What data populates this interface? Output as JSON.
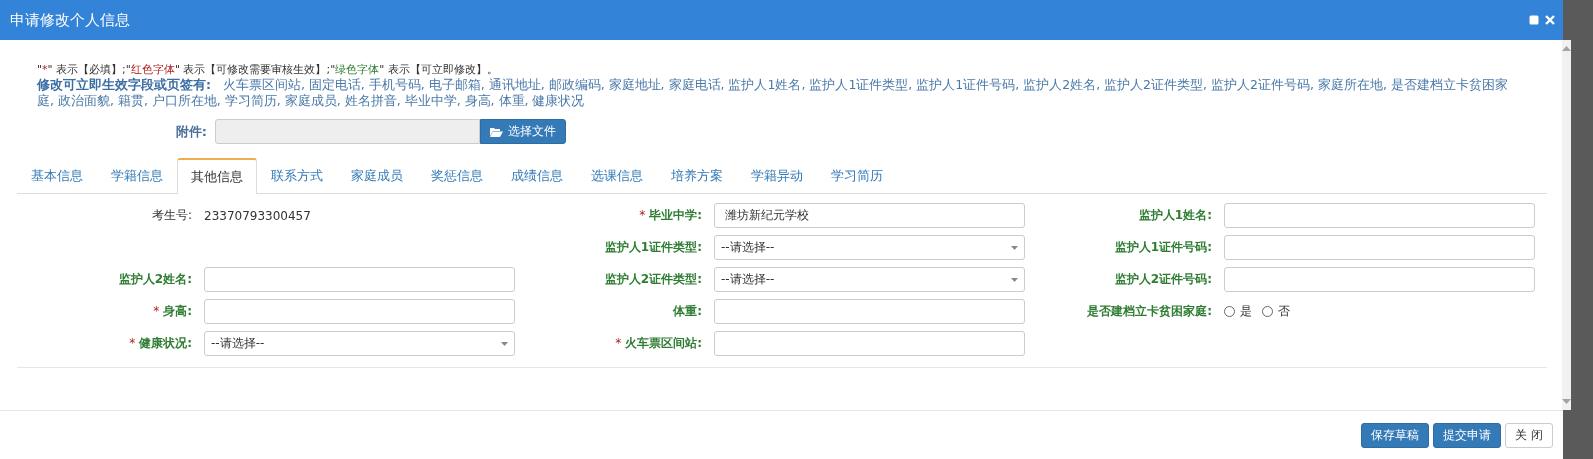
{
  "window": {
    "title": "申请修改个人信息"
  },
  "legend": [
    {
      "text": "\"",
      "kind": "plain"
    },
    {
      "text": "*",
      "kind": "red"
    },
    {
      "text": "\" 表示【必填】;\"",
      "kind": "plain"
    },
    {
      "text": "红色字体",
      "kind": "red"
    },
    {
      "text": "\" 表示【可修改需要审核生效】;\"",
      "kind": "plain"
    },
    {
      "text": "绿色字体",
      "kind": "green"
    },
    {
      "text": "\" 表示【可立即修改】。",
      "kind": "plain"
    }
  ],
  "instant_fields": {
    "label": "修改可立即生效字段或页签有:",
    "text": "火车票区间站, 固定电话, 手机号码, 电子邮箱, 通讯地址, 邮政编码, 家庭地址, 家庭电话, 监护人1姓名, 监护人1证件类型, 监护人1证件号码, 监护人2姓名, 监护人2证件类型, 监护人2证件号码, 家庭所在地, 是否建档立卡贫困家庭, 政治面貌, 籍贯, 户口所在地, 学习简历, 家庭成员, 姓名拼音, 毕业中学, 身高, 体重, 健康状况"
  },
  "attachment": {
    "label": "附件:",
    "button": "选择文件"
  },
  "tabs": [
    {
      "label": "基本信息",
      "selected": false
    },
    {
      "label": "学籍信息",
      "selected": false
    },
    {
      "label": "其他信息",
      "selected": true
    },
    {
      "label": "联系方式",
      "selected": false
    },
    {
      "label": "家庭成员",
      "selected": false
    },
    {
      "label": "奖惩信息",
      "selected": false
    },
    {
      "label": "成绩信息",
      "selected": false
    },
    {
      "label": "选课信息",
      "selected": false
    },
    {
      "label": "培养方案",
      "selected": false
    },
    {
      "label": "学籍异动",
      "selected": false
    },
    {
      "label": "学习简历",
      "selected": false
    }
  ],
  "form": [
    {
      "kind": "readonly",
      "label": "考生号:",
      "required": false,
      "value": "23370793300457"
    },
    {
      "kind": "text",
      "label": "毕业中学:",
      "required": true,
      "value": "潍坊新纪元学校"
    },
    {
      "kind": "text",
      "label": "监护人1姓名:",
      "required": false
    },
    {
      "kind": "blank"
    },
    {
      "kind": "select",
      "label": "监护人1证件类型:",
      "required": false,
      "value": "--请选择--"
    },
    {
      "kind": "text",
      "label": "监护人1证件号码:",
      "required": false
    },
    {
      "kind": "text",
      "label": "监护人2姓名:",
      "required": false
    },
    {
      "kind": "select",
      "label": "监护人2证件类型:",
      "required": false,
      "value": "--请选择--"
    },
    {
      "kind": "text",
      "label": "监护人2证件号码:",
      "required": false
    },
    {
      "kind": "text",
      "label": "身高:",
      "required": true
    },
    {
      "kind": "text",
      "label": "体重:",
      "required": false
    },
    {
      "kind": "radio",
      "label": "是否建档立卡贫困家庭:",
      "required": false,
      "options": [
        {
          "label": "是",
          "selected": false
        },
        {
          "label": "否",
          "selected": false
        }
      ]
    },
    {
      "kind": "select",
      "label": "健康状况:",
      "required": true,
      "value": "--请选择--"
    },
    {
      "kind": "text",
      "label": "火车票区间站:",
      "required": true
    }
  ],
  "buttons": [
    {
      "label": "保存草稿",
      "kind": "primary"
    },
    {
      "label": "提交申请",
      "kind": "primary"
    },
    {
      "label": "关 闭",
      "kind": "default"
    }
  ]
}
